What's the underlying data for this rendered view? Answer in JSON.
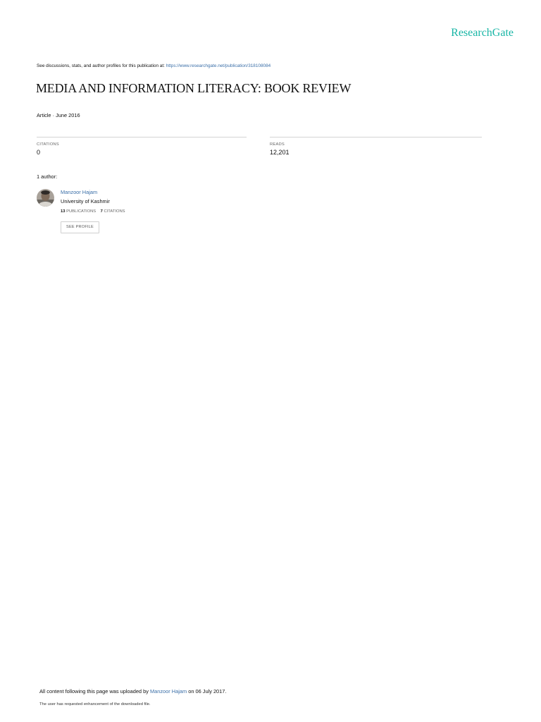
{
  "brand": {
    "logo_text": "ResearchGate",
    "accent_color": "#19b6a6",
    "link_color": "#3b6fa8"
  },
  "header": {
    "discussion_prefix": "See discussions, stats, and author profiles for this publication at:",
    "publication_url": "https://www.researchgate.net/publication/318108084"
  },
  "publication": {
    "title": "MEDIA AND INFORMATION LITERACY: BOOK REVIEW",
    "type_date": "Article · June 2016"
  },
  "stats": {
    "citations_label": "CITATIONS",
    "citations_value": "0",
    "reads_label": "READS",
    "reads_value": "12,201"
  },
  "authors": {
    "heading": "1 author:",
    "list": [
      {
        "name": "Manzoor Hajam",
        "institution": "University of Kashmir",
        "publications_count": "13",
        "publications_label": "PUBLICATIONS",
        "citations_count": "7",
        "citations_label": "CITATIONS",
        "profile_button": "SEE PROFILE",
        "avatar_icon": "author-avatar"
      }
    ]
  },
  "footer": {
    "upload_prefix": "All content following this page was uploaded by",
    "uploader": "Manzoor Hajam",
    "upload_suffix": "on 06 July 2017.",
    "note": "The user has requested enhancement of the downloaded file."
  }
}
